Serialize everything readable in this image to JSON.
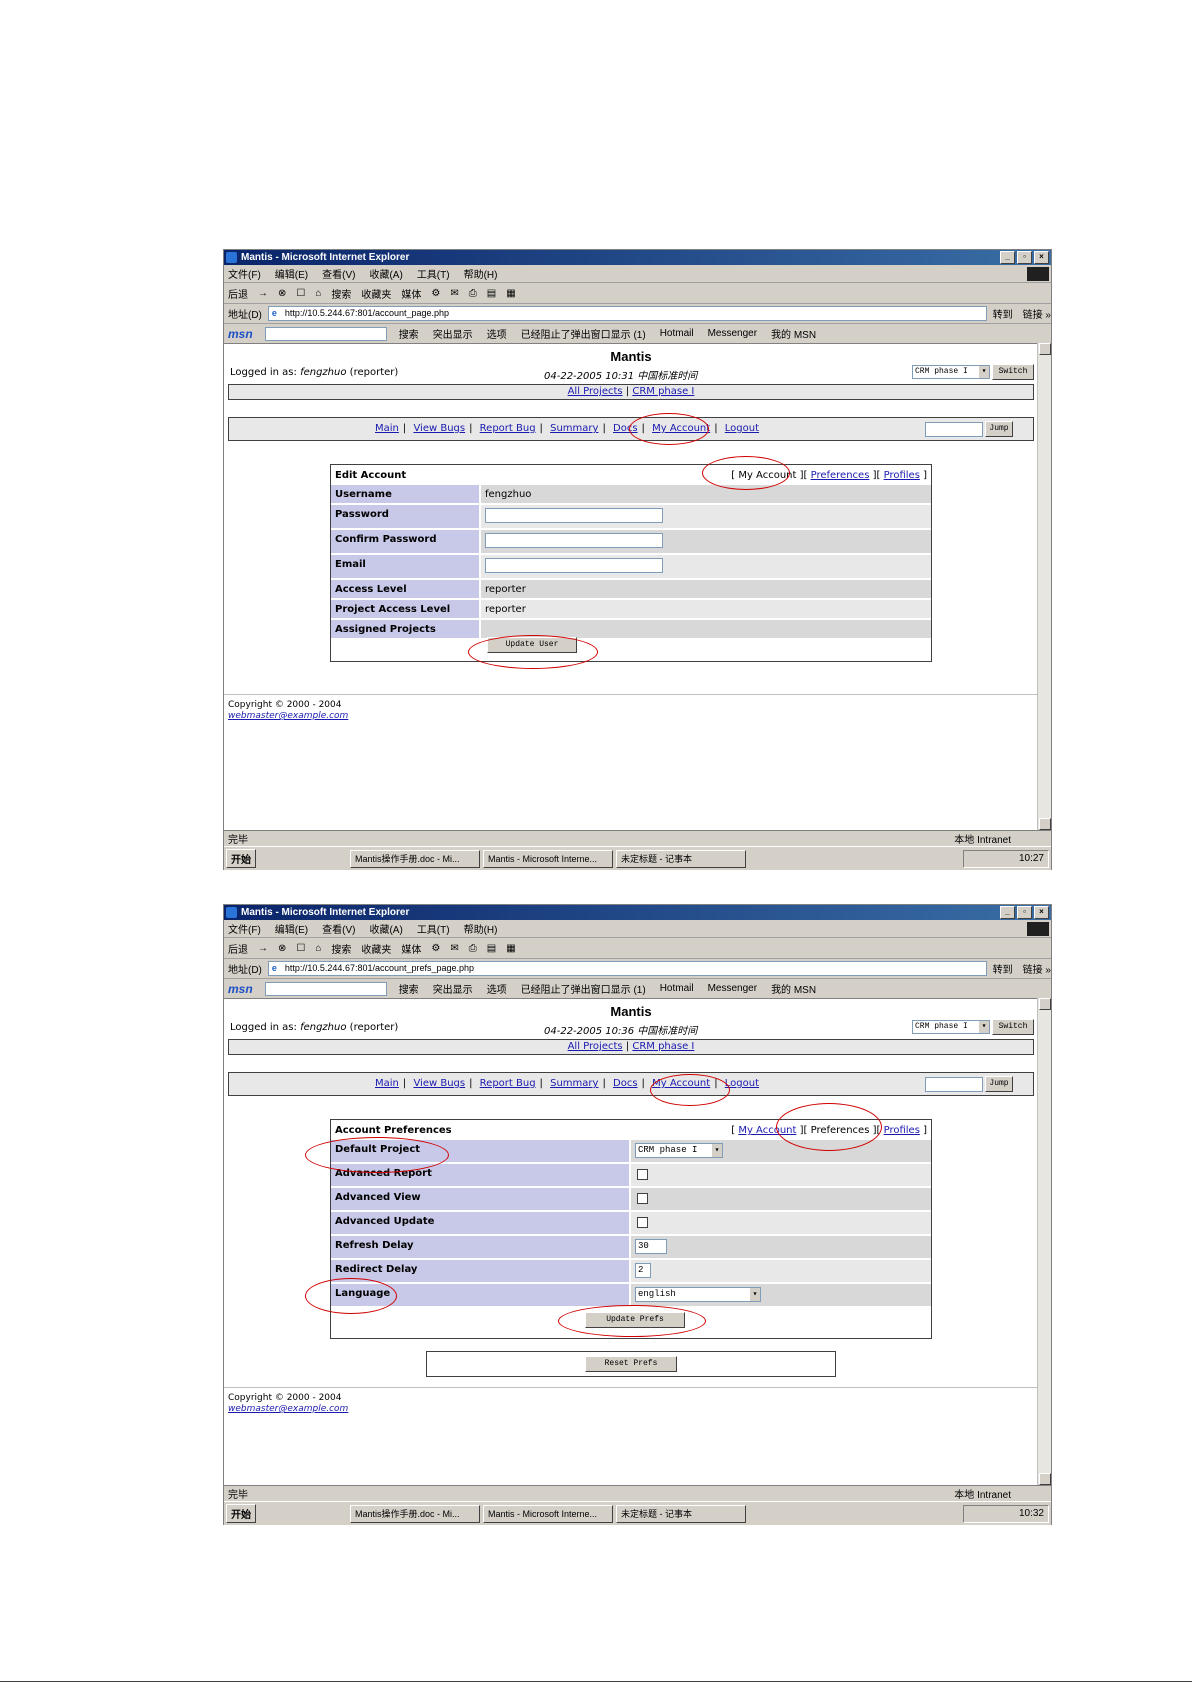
{
  "window": {
    "title": "Mantis - Microsoft Internet Explorer",
    "menu": [
      "文件(F)",
      "编辑(E)",
      "查看(V)",
      "收藏(A)",
      "工具(T)",
      "帮助(H)"
    ],
    "toolbar": [
      "后退",
      "→",
      "⊗",
      "☐",
      "⌂",
      "搜索",
      "收藏夹",
      "媒体",
      "⚙",
      "✉",
      "⎙",
      "▤",
      "▦"
    ],
    "address_label": "地址(D)",
    "go": "转到",
    "links": "链接 »",
    "msn": {
      "logo": "msn",
      "buttons": [
        "搜索",
        "突出显示",
        "选项",
        "已经阻止了弹出窗口显示 (1)",
        "Hotmail",
        "Messenger",
        "我的 MSN"
      ]
    },
    "status": "完毕",
    "zone": "本地 Intranet",
    "taskbar": {
      "start": "开始",
      "tasks": [
        "Mantis操作手册.doc - Mi...",
        "Mantis - Microsoft Interne...",
        "未定标题 - 记事本"
      ]
    }
  },
  "mantis": {
    "title": "Mantis",
    "logged_prefix": "Logged in as:",
    "user": "fengzhuo",
    "role": "(reporter)",
    "project_select": "CRM phase I",
    "switch": "Switch",
    "projects": [
      "All Projects",
      "CRM phase I"
    ],
    "nav": [
      "Main",
      "View Bugs",
      "Report Bug",
      "Summary",
      "Docs",
      "My Account",
      "Logout"
    ],
    "jump": "Jump",
    "tabs": [
      "My Account",
      "Preferences",
      "Profiles"
    ],
    "copyright": "Copyright © 2000 - 2004",
    "email": "webmaster@example.com"
  },
  "shot1": {
    "url": "http://10.5.244.67:801/account_page.php",
    "date": "04-22-2005 10:31 中国标准时间",
    "clock": "10:27",
    "form_title": "Edit Account",
    "rows": [
      {
        "label": "Username",
        "value": "fengzhuo"
      },
      {
        "label": "Password",
        "value": ""
      },
      {
        "label": "Confirm Password",
        "value": ""
      },
      {
        "label": "Email",
        "value": ""
      },
      {
        "label": "Access Level",
        "value": "reporter"
      },
      {
        "label": "Project Access Level",
        "value": "reporter"
      },
      {
        "label": "Assigned Projects",
        "value": ""
      }
    ],
    "submit": "Update User"
  },
  "shot2": {
    "url": "http://10.5.244.67:801/account_prefs_page.php",
    "date": "04-22-2005 10:36 中国标准时间",
    "clock": "10:32",
    "form_title": "Account Preferences",
    "rows": [
      {
        "label": "Default Project",
        "value": "CRM phase I"
      },
      {
        "label": "Advanced Report",
        "value": ""
      },
      {
        "label": "Advanced View",
        "value": ""
      },
      {
        "label": "Advanced Update",
        "value": ""
      },
      {
        "label": "Refresh Delay",
        "value": "30"
      },
      {
        "label": "Redirect Delay",
        "value": "2"
      },
      {
        "label": "Language",
        "value": "english"
      }
    ],
    "submit": "Update Prefs",
    "reset": "Reset Prefs"
  },
  "colors": {
    "annotation": "#d00000",
    "link": "#1a1ab0",
    "label_bg": "#c8c8e8"
  }
}
